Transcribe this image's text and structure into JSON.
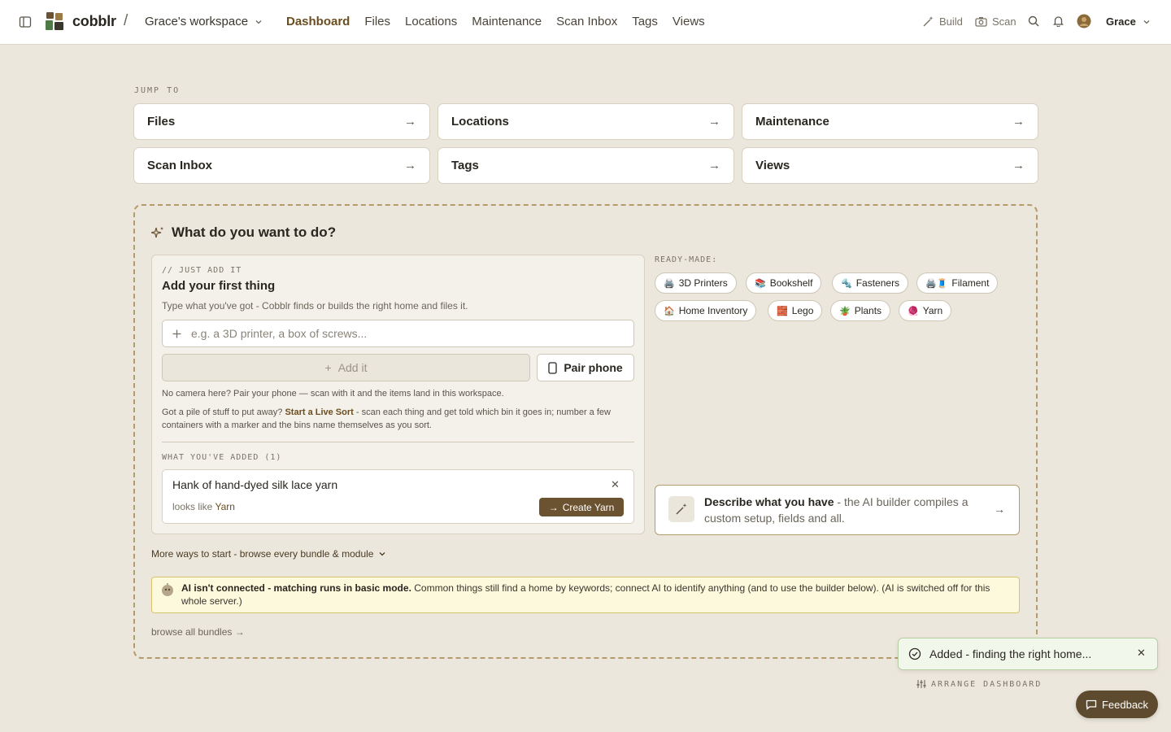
{
  "header": {
    "brand": "cobblr",
    "separator": "/",
    "workspace": "Grace's workspace",
    "nav": [
      "Dashboard",
      "Files",
      "Locations",
      "Maintenance",
      "Scan Inbox",
      "Tags",
      "Views"
    ],
    "active_nav": "Dashboard",
    "build_label": "Build",
    "scan_label": "Scan",
    "user_name": "Grace"
  },
  "jump": {
    "label": "JUMP TO",
    "items": [
      "Files",
      "Locations",
      "Maintenance",
      "Scan Inbox",
      "Tags",
      "Views"
    ]
  },
  "panel": {
    "title": "What do you want to do?",
    "add": {
      "kicker": "// JUST ADD IT",
      "title": "Add your first thing",
      "description": "Type what you've got - Cobblr finds or builds the right home and files it.",
      "input_placeholder": "e.g. a 3D printer, a box of screws...",
      "add_button": "Add it",
      "pair_button": "Pair phone",
      "note_camera": "No camera here? Pair your phone — scan with it and the items land in this workspace.",
      "note_pile_prefix": "Got a pile of stuff to put away?",
      "note_pile_link": "Start a Live Sort",
      "note_pile_suffix": "- scan each thing and get told which bin it goes in; number a few containers with a marker and the bins name themselves as you sort.",
      "added_label": "WHAT YOU'VE ADDED (1)",
      "added_items": [
        {
          "title": "Hank of hand-dyed silk lace yarn",
          "looks_like_prefix": "looks like",
          "category": "Yarn",
          "create_label": "Create Yarn"
        }
      ]
    },
    "ready_made": {
      "label": "READY-MADE:",
      "chips": [
        {
          "emoji": "🖨️",
          "label": "3D Printers"
        },
        {
          "emoji": "📚",
          "label": "Bookshelf"
        },
        {
          "emoji": "🔩",
          "label": "Fasteners"
        },
        {
          "emoji": "🖨️🧵",
          "label": "Filament"
        },
        {
          "emoji": "🏠",
          "label": "Home Inventory"
        },
        {
          "emoji": "🧱",
          "label": "Lego"
        },
        {
          "emoji": "🪴",
          "label": "Plants"
        },
        {
          "emoji": "🧶",
          "label": "Yarn"
        }
      ]
    },
    "describe": {
      "title": "Describe what you have",
      "text": " - the AI builder compiles a custom setup, fields and all."
    },
    "more_ways": "More ways to start - browse every bundle & module",
    "ai_banner": {
      "bold": "AI isn't connected - matching runs in basic mode.",
      "text": " Common things still find a home by keywords; connect AI to identify anything (and to use the builder below). (AI is switched off for this whole server.)"
    },
    "browse_all": "browse all bundles →"
  },
  "toast": {
    "text": "Added - finding the right home..."
  },
  "arrange_label": "ARRANGE DASHBOARD",
  "feedback_label": "Feedback",
  "colors": {
    "accent": "#6b4e1f",
    "button_dark": "#6b5230",
    "background": "#ece7dc",
    "banner_bg": "#fdf9dd",
    "toast_bg": "#f2f7ec"
  }
}
